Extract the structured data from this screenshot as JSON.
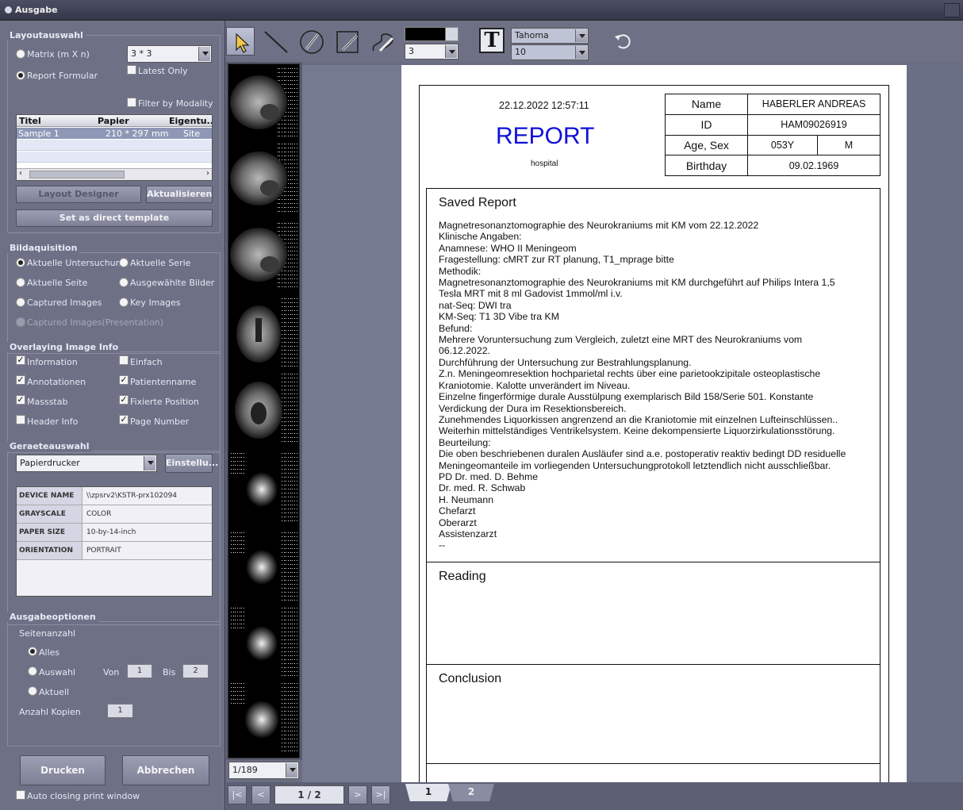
{
  "window": {
    "title": "Ausgabe"
  },
  "layout": {
    "title": "Layoutauswahl",
    "opt_matrix": "Matrix (m X n)",
    "opt_report": "Report Formular",
    "matrix_value": "3 * 3",
    "latest_only": "Latest Only",
    "filter_by_modality": "Filter by Modality",
    "columns": [
      "Titel",
      "Papier",
      "Eigentu..."
    ],
    "rows": [
      {
        "titel": "Sample 1",
        "papier": "210 * 297 mm",
        "eigentum": "Site"
      }
    ],
    "btn_designer": "Layout Designer",
    "btn_refresh": "Aktualisieren",
    "btn_template": "Set as direct template"
  },
  "acquisition": {
    "title": "Bildaquisition",
    "opt1": "Aktuelle Untersuchung",
    "opt2": "Aktuelle Serie",
    "opt3": "Aktuelle Seite",
    "opt4": "Ausgewählte Bilder",
    "opt5": "Captured Images",
    "opt6": "Key Images",
    "opt7": "Captured Images(Presentation)"
  },
  "overlay": {
    "title": "Overlaying Image Info",
    "c1": "Information",
    "c2": "Einfach",
    "c3": "Annotationen",
    "c4": "Patientenname",
    "c5": "Massstab",
    "c6": "Fixierte Position",
    "c7": "Header Info",
    "c8": "Page Number"
  },
  "device": {
    "title": "Geraeteauswahl",
    "printer": "Papierdrucker",
    "btn_settings": "Einstellu...",
    "rows": [
      {
        "k": "DEVICE NAME",
        "v": "\\\\zpsrv2\\KSTR-prx102094"
      },
      {
        "k": "GRAYSCALE",
        "v": "COLOR"
      },
      {
        "k": "PAPER SIZE",
        "v": "10-by-14-inch"
      },
      {
        "k": "ORIENTATION",
        "v": "PORTRAIT"
      }
    ]
  },
  "output": {
    "title": "Ausgabeoptionen",
    "pages": "Seitenanzahl",
    "opt_all": "Alles",
    "opt_sel": "Auswahl",
    "opt_cur": "Aktuell",
    "from": "Von",
    "from_val": "1",
    "to": "Bis",
    "to_val": "2",
    "copies": "Anzahl Kopien",
    "copies_val": "1"
  },
  "actions": {
    "print": "Drucken",
    "cancel": "Abbrechen",
    "auto_close": "Auto closing print window"
  },
  "toolbar": {
    "line_width": "3",
    "font": "Tahoma",
    "font_size": "10",
    "text_tool": "T"
  },
  "thumbs": {
    "counter": "1/189"
  },
  "nav": {
    "first": "|<",
    "prev": "<",
    "page": "1 / 2",
    "next": ">",
    "last": ">|",
    "tab1": "1",
    "tab2": "2"
  },
  "report": {
    "datetime": "22.12.2022 12:57:11",
    "heading": "REPORT",
    "hospital": "hospital",
    "name_label": "Name",
    "name": "HABERLER ANDREAS",
    "id_label": "ID",
    "id": "HAM09026919",
    "agesex_label": "Age, Sex",
    "age": "053Y",
    "sex": "M",
    "birthday_label": "Birthday",
    "birthday": "09.02.1969",
    "saved_title": "Saved Report",
    "body": "Magnetresonanztomographie des Neurokraniums mit KM vom 22.12.2022\nKlinische Angaben:\nAnamnese: WHO II Meningeom\nFragestellung: cMRT zur RT planung, T1_mprage bitte\nMethodik:\nMagnetresonanztomographie des Neurokraniums mit KM durchgeführt auf Philips Intera 1,5\nTesla MRT mit 8 ml Gadovist 1mmol/ml i.v.\nnat-Seq: DWI tra\nKM-Seq: T1 3D Vibe tra KM\nBefund:\nMehrere Voruntersuchung zum Vergleich, zuletzt eine MRT des Neurokraniums vom\n06.12.2022.\nDurchführung der Untersuchung zur Bestrahlungsplanung.\nZ.n. Meningeomresektion hochparietal rechts über eine parietookzipitale osteoplastische\nKraniotomie. Kalotte unverändert im Niveau.\nEinzelne fingerförmige durale Ausstülpung exemplarisch Bild 158/Serie 501. Konstante\nVerdickung der Dura im Resektionsbereich.\nZunehmendes Liquorkissen angrenzend an die Kraniotomie mit einzelnen Lufteinschlüssen..\nWeiterhin mittelständiges Ventrikelsystem. Keine dekompensierte Liquorzirkulationsstörung.\nBeurteilung:\nDie oben beschriebenen duralen Ausläufer sind a.e. postoperativ reaktiv bedingt DD residuelle\nMeningeomanteile im vorliegenden Untersuchungprotokoll letztendlich nicht ausschließbar.\nPD Dr. med. D. Behme\nDr. med. R. Schwab\nH. Neumann\nChefarzt\nOberarzt\nAssistenzarzt\n--",
    "reading_title": "Reading",
    "conclusion_title": "Conclusion"
  }
}
